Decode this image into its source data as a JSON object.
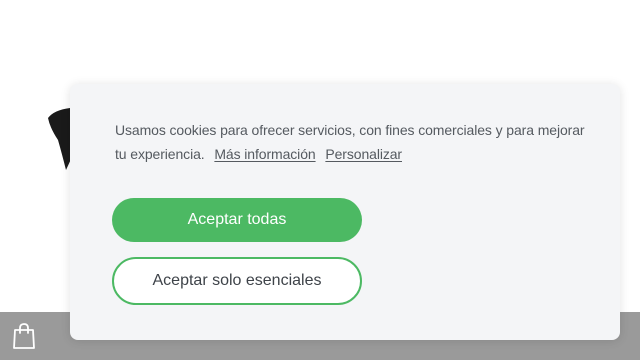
{
  "cookie_banner": {
    "message": "Usamos cookies para ofrecer servicios, con fines comerciales y para mejorar tu experiencia.",
    "more_info_link": "Más información",
    "customize_link": "Personalizar",
    "accept_all_label": "Aceptar todas",
    "accept_essential_label": "Aceptar solo esenciales",
    "accent_color": "#4cb963"
  },
  "bottom_bar": {
    "icon": "shopping-bag-icon",
    "color": "#9a9a9a"
  },
  "background_product": {
    "icon": "product-image"
  }
}
